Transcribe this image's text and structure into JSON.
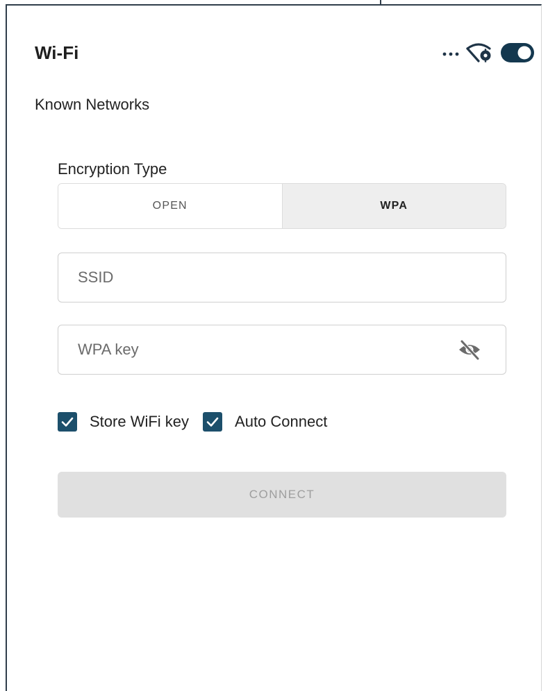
{
  "header": {
    "title": "Wi-Fi",
    "more_icon": "more-horizontal-icon",
    "wifi_settings_icon": "wifi-settings-icon",
    "toggle_state": "on"
  },
  "subtitle": "Known Networks",
  "form": {
    "encryption_label": "Encryption Type",
    "encryption_options": [
      "OPEN",
      "WPA"
    ],
    "encryption_selected": "WPA",
    "ssid": {
      "value": "",
      "placeholder": "SSID"
    },
    "wpa_key": {
      "value": "",
      "placeholder": "WPA key",
      "visibility_icon": "eye-off-icon"
    },
    "store_key": {
      "label": "Store WiFi key",
      "checked": true
    },
    "auto_connect": {
      "label": "Auto Connect",
      "checked": true
    },
    "connect_label": "CONNECT",
    "connect_enabled": false
  },
  "colors": {
    "checkbox": "#1c4f6b",
    "toggle": "#14384f",
    "disabled_button_bg": "#e0e0e0",
    "disabled_button_text": "#9e9e9e",
    "segment_active_bg": "#eeeeee"
  }
}
